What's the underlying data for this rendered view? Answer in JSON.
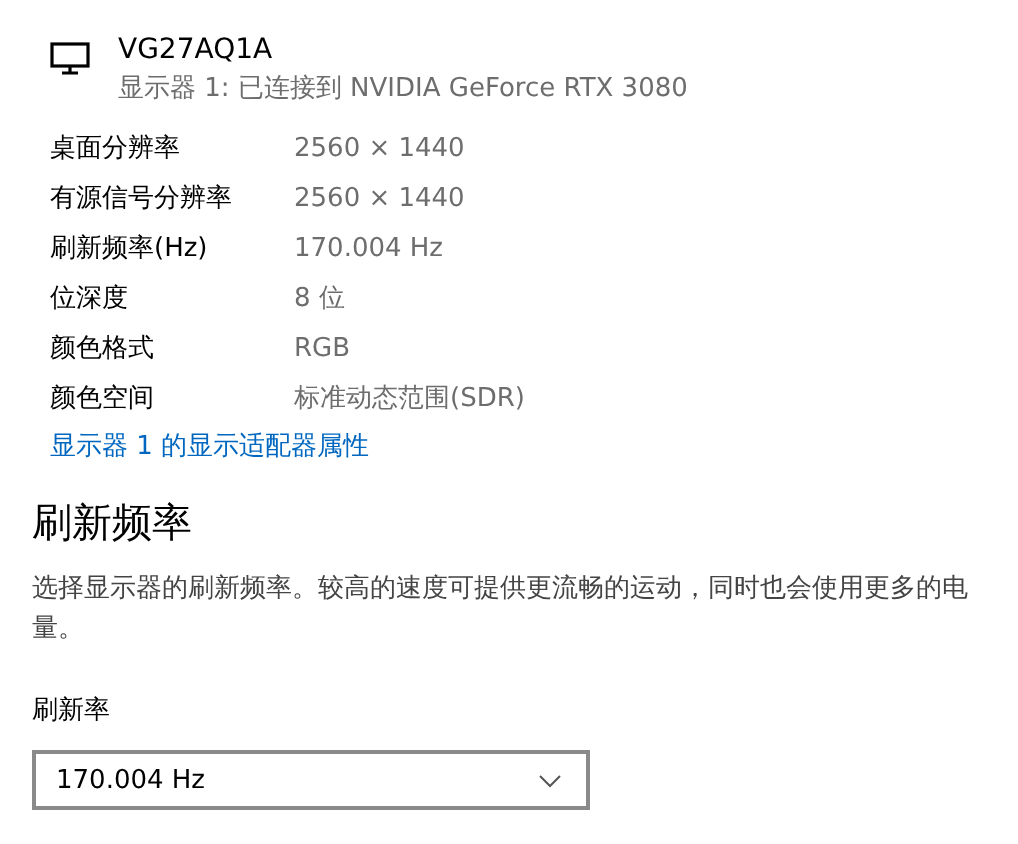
{
  "display": {
    "name": "VG27AQ1A",
    "subtitle": "显示器 1: 已连接到 NVIDIA GeForce RTX 3080"
  },
  "properties": [
    {
      "label": "桌面分辨率",
      "value": "2560 × 1440"
    },
    {
      "label": "有源信号分辨率",
      "value": "2560 × 1440"
    },
    {
      "label": "刷新频率(Hz)",
      "value": "170.004 Hz"
    },
    {
      "label": "位深度",
      "value": "8 位"
    },
    {
      "label": "颜色格式",
      "value": "RGB"
    },
    {
      "label": "颜色空间",
      "value": "标准动态范围(SDR)"
    }
  ],
  "adapter_link": "显示器 1 的显示适配器属性",
  "refresh_section": {
    "heading": "刷新频率",
    "description": "选择显示器的刷新频率。较高的速度可提供更流畅的运动，同时也会使用更多的电量。",
    "field_label": "刷新率",
    "dropdown": {
      "value": "170.004 Hz"
    }
  }
}
